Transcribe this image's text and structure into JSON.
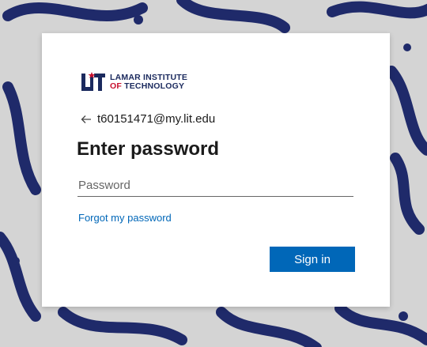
{
  "brand": {
    "line1": "LAMAR INSTITUTE",
    "line2_part1": "OF ",
    "line2_part2": "TECHNOLOGY",
    "logo_letters": "LIT"
  },
  "identity": {
    "back_icon": "arrow-left-icon",
    "email": "t60151471@my.lit.edu"
  },
  "title": "Enter password",
  "password": {
    "placeholder": "Password",
    "value": ""
  },
  "forgot_label": "Forgot my password",
  "signin_label": "Sign in",
  "colors": {
    "accent": "#0067b8",
    "brand_navy": "#1b2a5e",
    "brand_red": "#c8102e"
  }
}
